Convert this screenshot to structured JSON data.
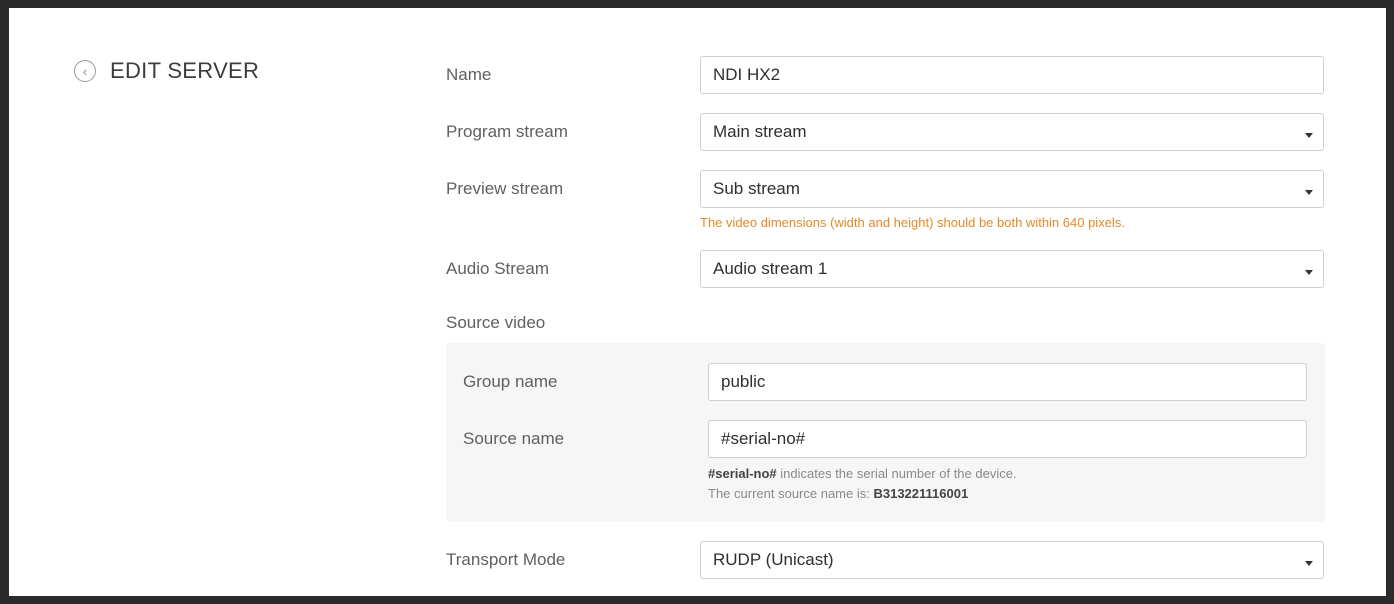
{
  "header": {
    "title": "EDIT SERVER"
  },
  "form": {
    "name": {
      "label": "Name",
      "value": "NDI HX2"
    },
    "program_stream": {
      "label": "Program stream",
      "value": "Main stream"
    },
    "preview_stream": {
      "label": "Preview stream",
      "value": "Sub stream",
      "hint": "The video dimensions (width and height) should be both within 640 pixels."
    },
    "audio_stream": {
      "label": "Audio Stream",
      "value": "Audio stream 1"
    },
    "source_video": {
      "label": "Source video",
      "group_name": {
        "label": "Group name",
        "value": "public"
      },
      "source_name": {
        "label": "Source name",
        "value": "#serial-no#"
      },
      "note_token": "#serial-no#",
      "note_text": " indicates the serial number of the device.",
      "current_prefix": "The current source name is: ",
      "current_value": "B313221116001"
    },
    "transport_mode": {
      "label": "Transport Mode",
      "value": "RUDP (Unicast)"
    }
  },
  "colors": {
    "hint": "#e08a2c",
    "panel_bg": "#f6f6f6"
  }
}
